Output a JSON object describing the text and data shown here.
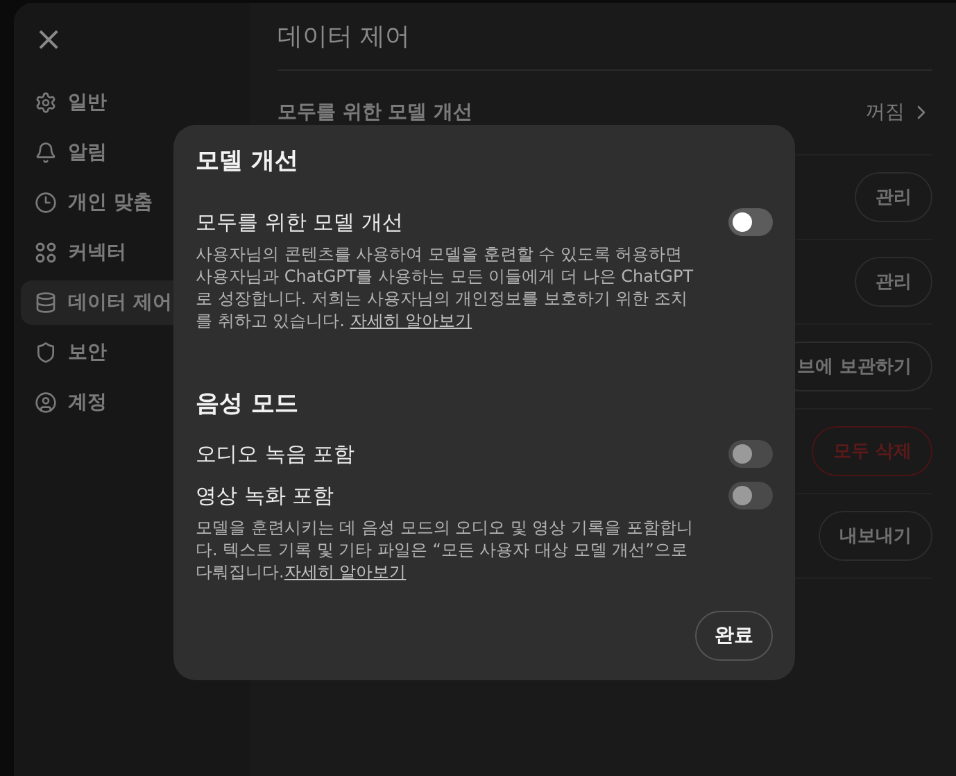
{
  "sidebar": {
    "close": "×",
    "items": [
      {
        "label": "일반",
        "selected": false
      },
      {
        "label": "알림",
        "selected": false
      },
      {
        "label": "개인 맞춤",
        "selected": false
      },
      {
        "label": "커넥터",
        "selected": false
      },
      {
        "label": "데이터 제어",
        "selected": true
      },
      {
        "label": "보안",
        "selected": false
      },
      {
        "label": "계정",
        "selected": false
      }
    ]
  },
  "content": {
    "title": "데이터 제어",
    "rows": [
      {
        "label": "모두를 위한 모델 개선",
        "kind": "link",
        "value": "꺼짐"
      },
      {
        "kind": "button",
        "button": "관리",
        "danger": false
      },
      {
        "kind": "button",
        "button": "관리",
        "danger": false
      },
      {
        "kind": "button",
        "button": "브에 보관하기",
        "danger": false
      },
      {
        "kind": "button",
        "button": "모두 삭제",
        "danger": true
      },
      {
        "kind": "button",
        "button": "내보내기",
        "danger": false
      }
    ]
  },
  "dialog": {
    "title": "모델 개선",
    "sections": [
      {
        "settings": [
          {
            "label": "모두를 위한 모델 개선",
            "on": false,
            "disabled": false
          }
        ],
        "description": "사용자님의 콘텐츠를 사용하여 모델을 훈련할 수 있도록 허용하면 사용자님과 ChatGPT를 사용하는 모든 이들에게 더 나은 ChatGPT로 성장합니다. 저희는 사용자님의 개인정보를 보호하기 위한 조치를 취하고 있습니다. ",
        "link": "자세히 알아보기"
      },
      {
        "heading": "음성 모드",
        "settings": [
          {
            "label": "오디오 녹음 포함",
            "on": false,
            "disabled": true
          },
          {
            "label": "영상 녹화 포함",
            "on": false,
            "disabled": true
          }
        ],
        "description": "모델을 훈련시키는 데 음성 모드의 오디오 및 영상 기록을 포함합니다. 텍스트 기록 및 기타 파일은 “모든 사용자 대상 모델 개선”으로 다뤄집니다.",
        "link": "자세히 알아보기"
      }
    ],
    "done": "완료"
  }
}
